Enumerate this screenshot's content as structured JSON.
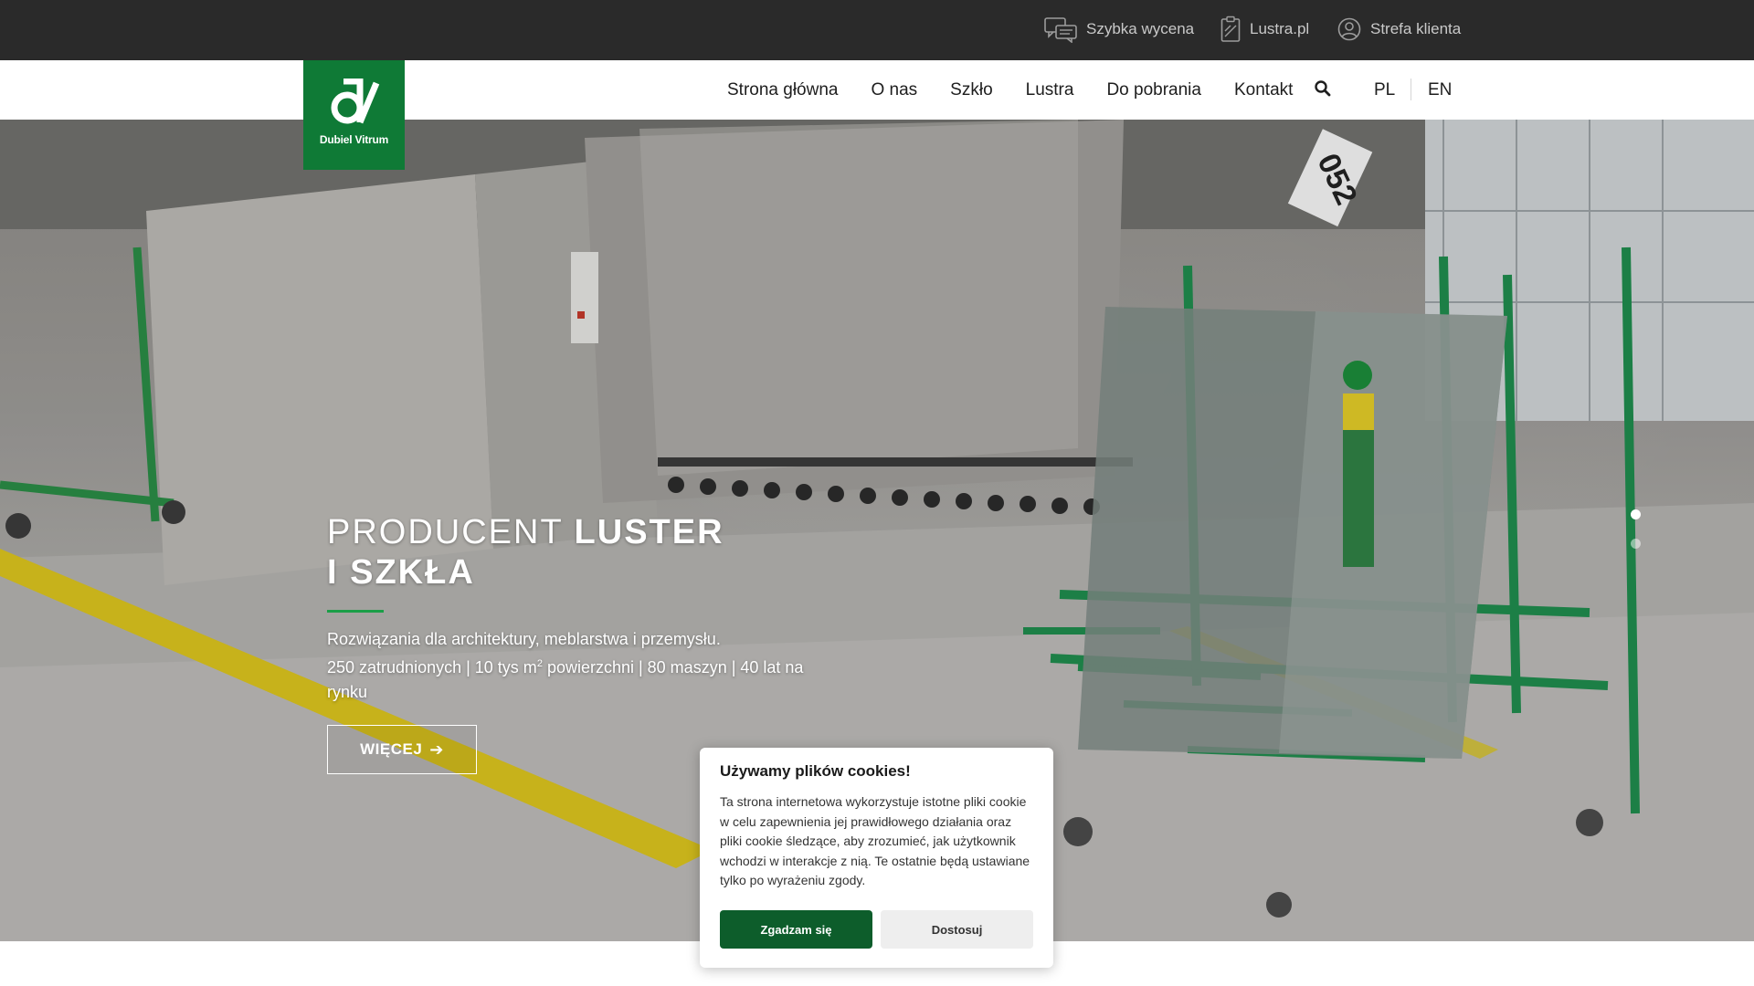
{
  "topbar": {
    "quick_quote": "Szybka wycena",
    "lustra_link": "Lustra.pl",
    "client_zone": "Strefa klienta"
  },
  "logo": {
    "brand": "Dubiel Vitrum"
  },
  "nav": {
    "items": [
      "Strona główna",
      "O nas",
      "Szkło",
      "Lustra",
      "Do pobrania",
      "Kontakt"
    ]
  },
  "lang": {
    "pl": "PL",
    "en": "EN"
  },
  "hero": {
    "title_light": "PRODUCENT ",
    "title_bold_1": "LUSTER",
    "title_bold_2": "I SZKŁA",
    "line1": "Rozwiązania dla architektury, meblarstwa i przemysłu.",
    "line2_a": "250 zatrudnionych | 10 tys m",
    "line2_sup": "2",
    "line2_b": " powierzchni | 80 maszyn | 40 lat na rynku",
    "more_label": "WIĘCEJ",
    "slider_active": 1,
    "slider_count": 2
  },
  "cookie": {
    "title": "Używamy plików cookies!",
    "text": "Ta strona internetowa wykorzystuje istotne pliki cookie w celu zapewnienia jej prawidłowego działania oraz pliki cookie śledzące, aby zrozumieć, jak użytkownik wchodzi w interakcje z nią. Te ostatnie będą ustawiane tylko po wyrażeniu zgody.",
    "accept_label": "Zgadzam się",
    "customize_label": "Dostosuj"
  },
  "colors": {
    "brand_green": "#0f7a36",
    "accept_green": "#0d5d2b",
    "topbar_bg": "#2a2a2a"
  }
}
